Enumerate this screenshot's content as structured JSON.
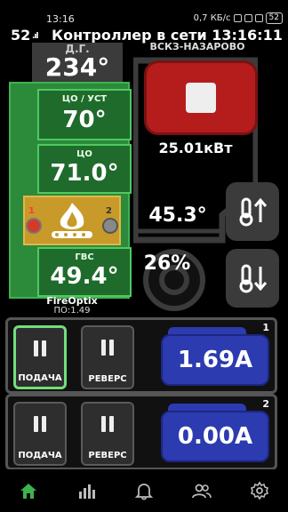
{
  "status_bar": {
    "time": "13:16",
    "net_speed": "0,7 КБ/с",
    "battery": "52"
  },
  "header": {
    "ping": "52",
    "signal": ".ıl",
    "title": "Контроллер в сети 13:16:11"
  },
  "flue": {
    "label": "Д.Г.",
    "value": "234°"
  },
  "site": {
    "name": "ВСКЗ-НАЗАРОВО"
  },
  "controller": {
    "co_set_label": "ЦО / УСТ",
    "co_set_value": "70°",
    "co_label": "ЦО",
    "co_value": "71.0°",
    "dhw_label": "ГВС",
    "dhw_value": "49.4°",
    "burner_left_num": "1",
    "burner_right_num": "2",
    "brand": "FireOptix",
    "firmware": "ПО:1.49"
  },
  "boiler": {
    "power": "25.01кВт",
    "temperature": "45.3°",
    "fan": "26%"
  },
  "pumps": [
    {
      "number": "1",
      "feed_label": "ПОДАЧА",
      "reverse_label": "РЕВЕРС",
      "current": "1.69A"
    },
    {
      "number": "2",
      "feed_label": "ПОДАЧА",
      "reverse_label": "РЕВЕРС",
      "current": "0.00A"
    }
  ],
  "colors": {
    "accent": "#3db34f",
    "stop": "#b51d1d",
    "pump_current": "#2d3bb0",
    "nav_active": "#3db34f"
  },
  "nav": [
    "home-icon",
    "stats-icon",
    "bell-icon",
    "users-icon",
    "gear-icon"
  ]
}
